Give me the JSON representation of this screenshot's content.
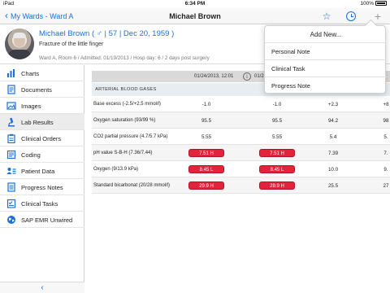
{
  "status_bar": {
    "carrier": "iPad",
    "time": "6:34 PM",
    "battery": "100%"
  },
  "nav": {
    "back_label": "My Wards - Ward A",
    "title": "Michael Brown"
  },
  "patient": {
    "name_line": "Michael Brown ( ♂ | 57 | Dec 20, 1959 )",
    "diagnosis": "Fracture of the little finger",
    "meta": "Ward A, Room 6 / Admitted: 01/19/2013 / Hosp day: 6 / 2 days post surgery"
  },
  "sidebar": {
    "items": [
      {
        "label": "Charts",
        "icon": "bar-chart-icon"
      },
      {
        "label": "Documents",
        "icon": "document-icon"
      },
      {
        "label": "Images",
        "icon": "image-icon"
      },
      {
        "label": "Lab Results",
        "icon": "microscope-icon",
        "active": true
      },
      {
        "label": "Clinical Orders",
        "icon": "clipboard-icon"
      },
      {
        "label": "Coding",
        "icon": "coding-icon"
      },
      {
        "label": "Patient Data",
        "icon": "id-card-icon"
      },
      {
        "label": "Progress Notes",
        "icon": "notes-icon"
      },
      {
        "label": "Clinical Tasks",
        "icon": "checklist-icon"
      },
      {
        "label": "SAP EMR Unwired",
        "icon": "globe-icon"
      }
    ],
    "collapse_label": "‹"
  },
  "lab_table": {
    "columns": [
      "01/24/2013, 12:01",
      "01/23",
      "",
      ""
    ],
    "section": "ARTERIAL BLOOD GASES",
    "rows": [
      {
        "label": "Base excess (-2.5/+2.5 mmol/l)",
        "values": [
          "-1.0",
          "-1.0",
          "+2.3",
          "+8"
        ],
        "flags": [
          false,
          false,
          false,
          false
        ]
      },
      {
        "label": "Oxygen saturation (93/99 %)",
        "values": [
          "95.5",
          "95.5",
          "94.2",
          "98"
        ],
        "flags": [
          false,
          false,
          false,
          false
        ]
      },
      {
        "label": "CO2 partial pressure (4.7/5.7 kPa)",
        "values": [
          "5.55",
          "5.55",
          "5.4",
          "5."
        ],
        "flags": [
          false,
          false,
          false,
          false
        ]
      },
      {
        "label": "pH value S-B-H (7.36/7.44)",
        "values": [
          "7.51 H",
          "7.51 H",
          "7.39",
          "7."
        ],
        "flags": [
          true,
          true,
          false,
          false
        ]
      },
      {
        "label": "Oxygen (9/13.9 kPa)",
        "values": [
          "8.45 L",
          "8.45 L",
          "10.0",
          "9."
        ],
        "flags": [
          true,
          true,
          false,
          false
        ]
      },
      {
        "label": "Standard bicarbonat (20/28 mmol/l)",
        "values": [
          "29.9 H",
          "29.9 H",
          "25.5",
          "27"
        ],
        "flags": [
          true,
          true,
          false,
          false
        ]
      }
    ]
  },
  "popover": {
    "title": "Add New...",
    "items": [
      "Personal Note",
      "Clinical Task",
      "Progress Note"
    ]
  },
  "colors": {
    "accent": "#1a6fdc",
    "flag": "#e2233b",
    "header_gray": "#d9d9d9"
  }
}
